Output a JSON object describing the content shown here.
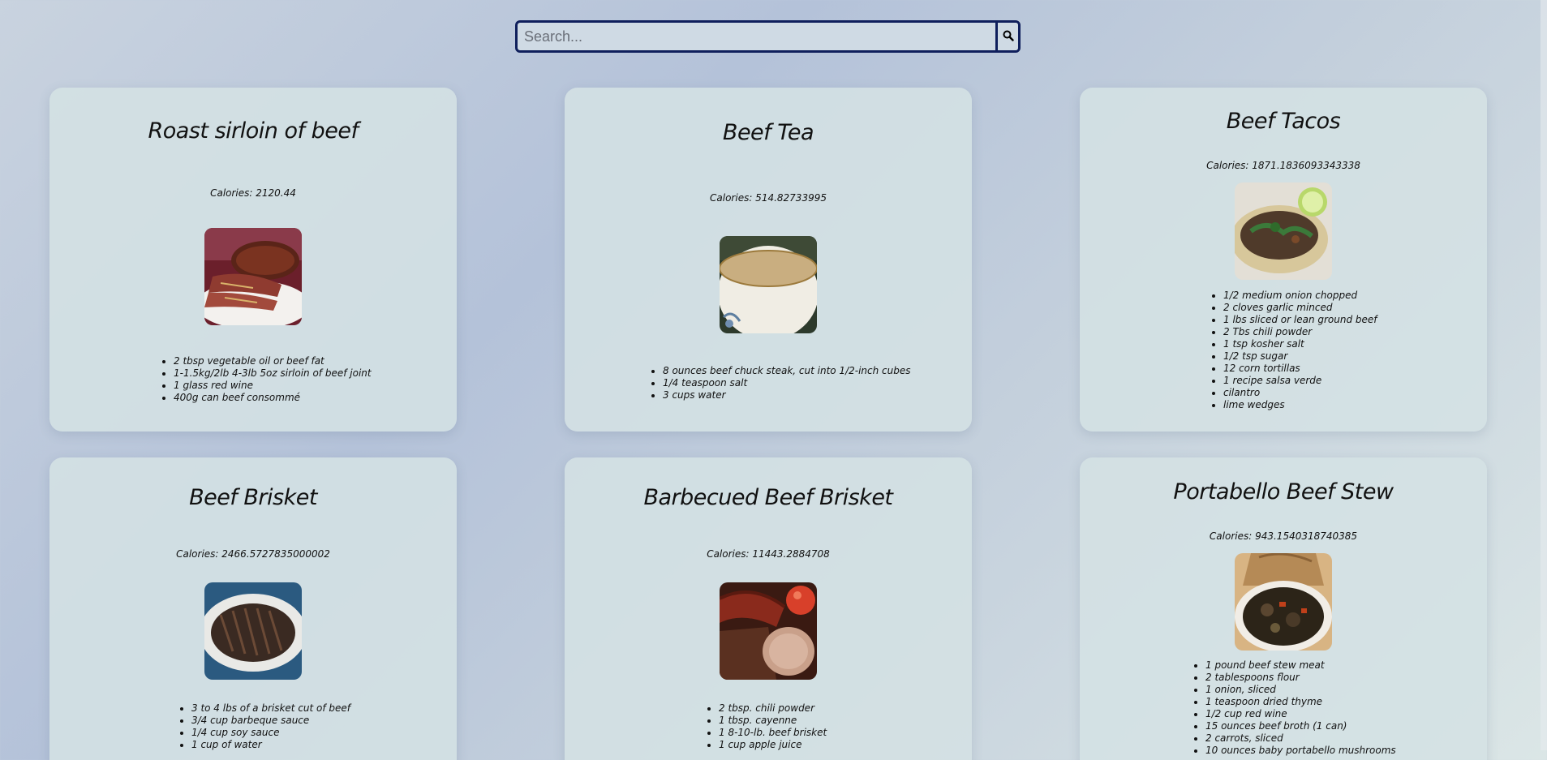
{
  "search": {
    "placeholder": "Search..."
  },
  "icons": {
    "search": "search-icon"
  },
  "colors": {
    "search_border": "#0f1f5c"
  },
  "recipes": [
    {
      "title": "Roast sirloin of beef",
      "calories": "Calories: 2120.44",
      "image": "roast-sirloin-photo",
      "ingredients": [
        "2 tbsp vegetable oil or beef fat",
        "1-1.5kg/2lb 4-3lb 5oz sirloin of beef joint",
        "1 glass red wine",
        "400g can beef consommé"
      ]
    },
    {
      "title": "Beef Tea",
      "calories": "Calories: 514.82733995",
      "image": "beef-tea-photo",
      "ingredients": [
        "8 ounces beef chuck steak, cut into 1/2-inch cubes",
        "1/4 teaspoon salt",
        "3 cups water"
      ]
    },
    {
      "title": "Beef Tacos",
      "calories": "Calories: 1871.1836093343338",
      "image": "beef-tacos-photo",
      "ingredients": [
        "1/2 medium onion chopped",
        "2 cloves garlic minced",
        "1 lbs sliced or lean ground beef",
        "2 Tbs chili powder",
        "1 tsp kosher salt",
        "1/2 tsp sugar",
        "12 corn tortillas",
        "1 recipe salsa verde",
        "cilantro",
        "lime wedges"
      ]
    },
    {
      "title": "Beef Brisket",
      "calories": "Calories: 2466.5727835000002",
      "image": "beef-brisket-photo",
      "ingredients": [
        "3 to 4 lbs of a brisket cut of beef",
        "3/4 cup barbeque sauce",
        "1/4 cup soy sauce",
        "1 cup of water"
      ]
    },
    {
      "title": "Barbecued Beef Brisket",
      "calories": "Calories: 11443.2884708",
      "image": "barbecued-brisket-photo",
      "ingredients": [
        "2 tbsp. chili powder",
        "1 tbsp. cayenne",
        "1 8-10-lb. beef brisket",
        "1 cup apple juice"
      ]
    },
    {
      "title": "Portabello Beef Stew",
      "calories": "Calories: 943.1540318740385",
      "image": "beef-stew-photo",
      "ingredients": [
        "1 pound beef stew meat",
        "2 tablespoons flour",
        "1 onion, sliced",
        "1 teaspoon dried thyme",
        "1/2 cup red wine",
        "15 ounces beef broth (1 can)",
        "2 carrots, sliced",
        "10 ounces baby portabello mushrooms"
      ]
    }
  ]
}
